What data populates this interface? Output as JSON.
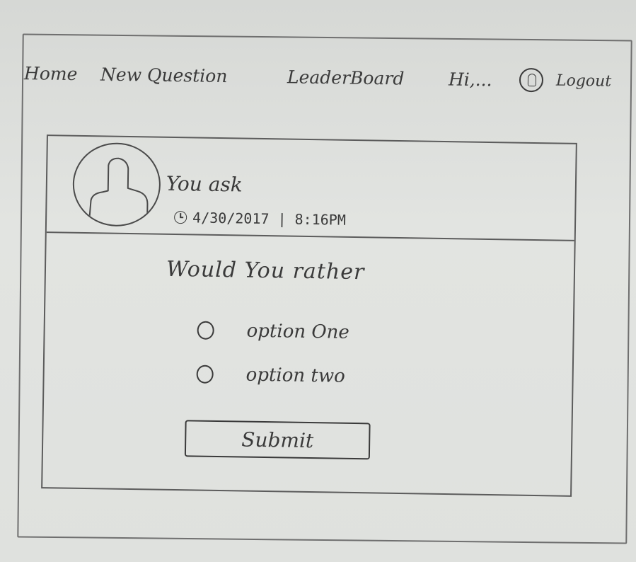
{
  "nav": {
    "home_label": "Home",
    "new_question_label": "New Question",
    "leaderboard_label": "LeaderBoard",
    "greeting": "Hi,...",
    "logout_label": "Logout",
    "user_icon": "user-circle-icon"
  },
  "question_card": {
    "avatar_icon": "user-avatar-icon",
    "asker": "You ask",
    "clock_icon": "clock-icon",
    "timestamp": "4/30/2017 | 8:16PM",
    "prompt": "Would You rather",
    "options": [
      {
        "label": "option One",
        "selected": false
      },
      {
        "label": "option two",
        "selected": false
      }
    ],
    "submit_label": "Submit"
  }
}
